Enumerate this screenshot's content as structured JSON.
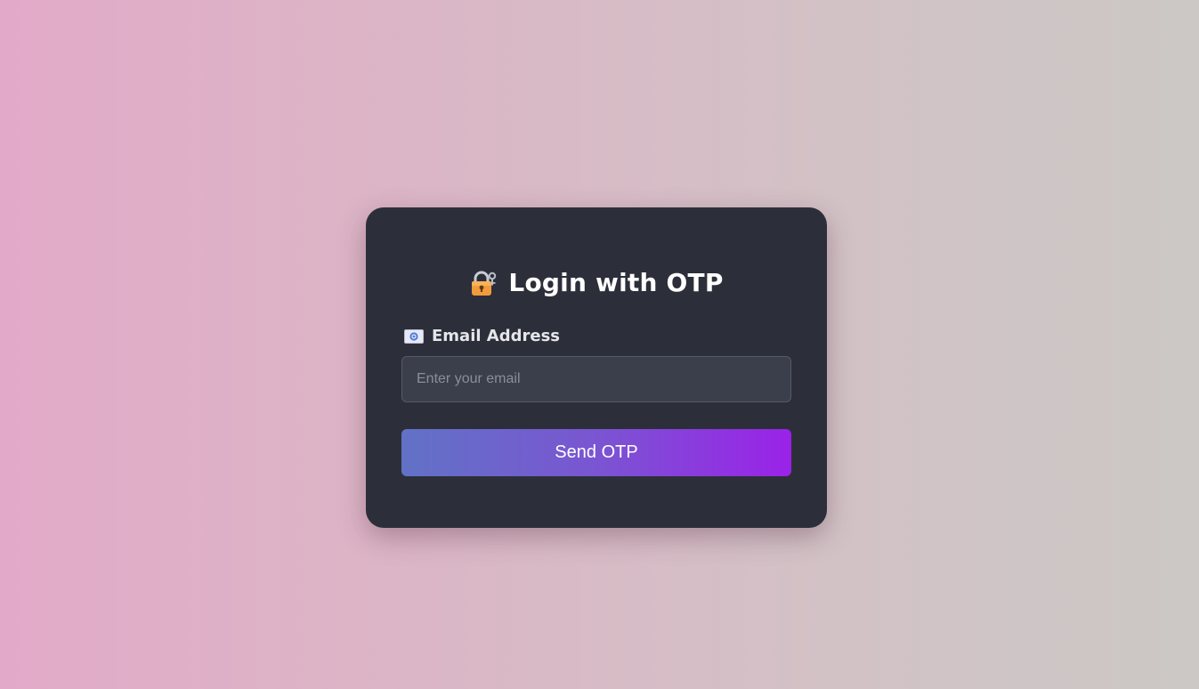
{
  "login": {
    "title": "Login with OTP",
    "title_icon": "lock-with-key-icon",
    "email_label": "Email Address",
    "email_icon": "envelope-icon",
    "email_value": "",
    "email_placeholder": "Enter your email",
    "submit_label": "Send OTP"
  },
  "colors": {
    "card_background": "#2c2f3a",
    "input_background": "#3b3f4c",
    "button_gradient_start": "#6172c6",
    "button_gradient_end": "#9a22e8",
    "page_gradient_start": "#e2aac8",
    "page_gradient_end": "#cbc8c5"
  }
}
